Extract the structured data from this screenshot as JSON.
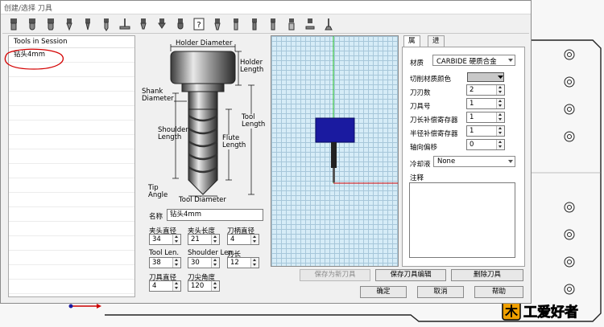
{
  "window": {
    "title": "创建/选择 刀具"
  },
  "toolbar": {
    "buttons": [
      {
        "icon": "endmill-flat-icon"
      },
      {
        "icon": "endmill-ball-icon"
      },
      {
        "icon": "endmill-bull-icon"
      },
      {
        "icon": "vbit-icon"
      },
      {
        "icon": "engrave-icon"
      },
      {
        "icon": "drill-icon"
      },
      {
        "icon": "lollipop-icon"
      },
      {
        "icon": "chamfer-icon"
      },
      {
        "icon": "countersink-icon"
      },
      {
        "icon": "round-icon"
      },
      {
        "icon": "unknown-tool-icon"
      },
      {
        "icon": "taper-icon"
      },
      {
        "icon": "tap-icon"
      },
      {
        "icon": "reamer-icon"
      },
      {
        "icon": "boring-icon"
      },
      {
        "icon": "thread-mill-icon"
      },
      {
        "icon": "slot-cutter-icon"
      },
      {
        "icon": "dovetail-icon"
      }
    ]
  },
  "tool_list": {
    "header": "Tools in Session",
    "items": [
      "钻头4mm"
    ]
  },
  "diagram": {
    "holder_diameter": "Holder Diameter",
    "holder_length": "Holder Length",
    "shank_diameter": "Shank Diameter",
    "shoulder_length": "Shoulder Length",
    "tool_length": "Tool Length",
    "flute_length": "Flute Length",
    "tip_angle": "Tip Angle",
    "tool_diameter": "Tool Diameter"
  },
  "params": {
    "name_label": "名称",
    "name_value": "钻头4mm",
    "holder_dia_label": "夹头直径",
    "holder_dia": "34",
    "holder_len_label": "夹头长度",
    "holder_len": "21",
    "shank_dia_label": "刀柄直径",
    "shank_dia": "4",
    "tool_len_label": "Tool Len.",
    "tool_len": "38",
    "shoulder_len_label": "Shoulder Len.",
    "shoulder_len": "30",
    "flute_len_label": "刃长",
    "flute_len": "12",
    "tool_dia_label": "刀具直径",
    "tool_dia": "4",
    "tip_angle_label": "刀尖角度",
    "tip_angle": "120"
  },
  "props": {
    "tab_properties": "属性",
    "tab_feeds": "进给速度",
    "material_label": "材质",
    "material_value": "CARBIDE 硬质合金",
    "cut_color_label": "切削材质颜色",
    "flutes_label": "刀刃数",
    "flutes": "2",
    "tool_number_label": "刀具号",
    "tool_number": "1",
    "length_offset_label": "刀长补偿寄存器",
    "length_offset": "1",
    "radius_offset_label": "半径补偿寄存器",
    "radius_offset": "1",
    "axial_offset_label": "轴向偏移",
    "axial_offset": "0",
    "coolant_label": "冷却液",
    "coolant_value": "None",
    "notes_label": "注释"
  },
  "buttons": {
    "save_as_new": "保存为新刀具",
    "save_edits": "保存刀具编辑",
    "delete": "删除刀具",
    "ok": "确定",
    "cancel": "取消",
    "help": "帮助"
  },
  "watermark": {
    "text": "木工爱好者"
  },
  "colors": {
    "preview_bg": "#d6ecf7",
    "holder_blue": "#1a1aa0",
    "accent_red": "#cc0000",
    "grid_line": "#a7c7da"
  }
}
